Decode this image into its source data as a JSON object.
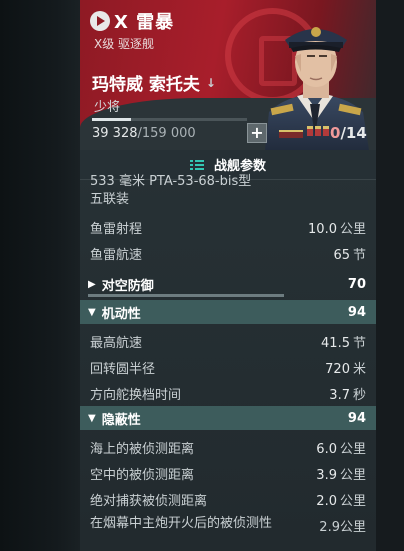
{
  "header": {
    "ship_name": "X  雷暴",
    "ship_subtitle": "X级  驱逐舰",
    "commander_name": "玛特威 索托夫",
    "commander_rank": "少将",
    "xp_current": "39 328",
    "xp_total": "/159 000",
    "xp_progress": 0.25,
    "points_zero": "0",
    "points_total": "/14",
    "plus_label": "+"
  },
  "params": {
    "title": "战舰参数"
  },
  "torpedo": {
    "cut_line1": "533 毫米 PTA-53-68-bis型",
    "cut_line2": "五联装",
    "rows": [
      {
        "label": "鱼雷射程",
        "value": "10.0",
        "unit": "公里"
      },
      {
        "label": "鱼雷航速",
        "value": "65",
        "unit": "节"
      }
    ]
  },
  "sections": {
    "aa": {
      "label": "对空防御",
      "value": "70",
      "level": 0.7
    },
    "maneuver": {
      "label": "机动性",
      "value": "94",
      "level": 0.94
    },
    "stealth": {
      "label": "隐蔽性",
      "value": "94",
      "level": 0.94
    }
  },
  "maneuver_rows": [
    {
      "label": "最高航速",
      "value": "41.5",
      "unit": "节"
    },
    {
      "label": "回转圆半径",
      "value": "720",
      "unit": "米"
    },
    {
      "label": "方向舵换档时间",
      "value": "3.7",
      "unit": "秒"
    }
  ],
  "stealth_rows": [
    {
      "label": "海上的被侦测距离",
      "value": "6.0",
      "unit": "公里"
    },
    {
      "label": "空中的被侦测距离",
      "value": "3.9",
      "unit": "公里"
    },
    {
      "label": "绝对捕获被侦测距离",
      "value": "2.0",
      "unit": "公里"
    },
    {
      "label": "在烟幕中主炮开火后的被侦测性",
      "value": "2.9",
      "unit": "公里"
    }
  ],
  "colors": {
    "banner": "#a81e2b",
    "accent_teal": "#33c7b3",
    "section_open": "#3d5c5c"
  }
}
